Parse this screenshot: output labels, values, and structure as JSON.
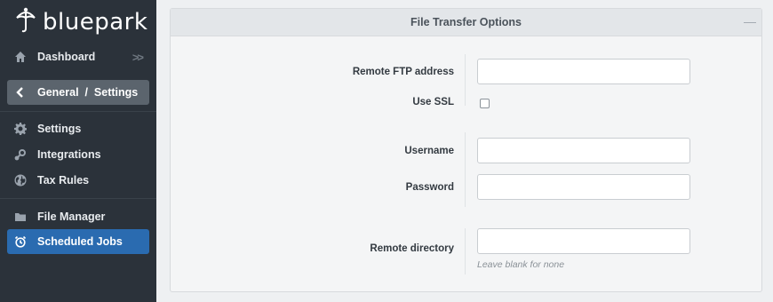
{
  "brand": {
    "name": "bluepark"
  },
  "sidebar": {
    "dashboard": {
      "label": "Dashboard",
      "icon": "home-icon",
      "expand": ">>"
    },
    "breadcrumb": {
      "label": "General  /  Settings",
      "icon": "chevron-left-icon"
    },
    "items": [
      {
        "label": "Settings",
        "icon": "gear-icon"
      },
      {
        "label": "Integrations",
        "icon": "integrations-icon"
      },
      {
        "label": "Tax Rules",
        "icon": "globe-icon"
      },
      {
        "label": "File Manager",
        "icon": "folder-icon"
      },
      {
        "label": "Scheduled Jobs",
        "icon": "alarm-clock-icon",
        "active": true
      }
    ]
  },
  "panel": {
    "title": "File Transfer Options",
    "collapse": "—",
    "fields": {
      "remote_ftp_address": {
        "label": "Remote FTP address",
        "value": ""
      },
      "use_ssl": {
        "label": "Use SSL",
        "checked": false
      },
      "username": {
        "label": "Username",
        "value": ""
      },
      "password": {
        "label": "Password",
        "value": ""
      },
      "remote_directory": {
        "label": "Remote directory",
        "value": "",
        "hint": "Leave blank for none"
      }
    }
  },
  "colors": {
    "sidebar_bg": "#2b323a",
    "active_item": "#2a6bb0",
    "breadcrumb_bg": "#5b646d",
    "panel_header": "#e3e6e9"
  }
}
